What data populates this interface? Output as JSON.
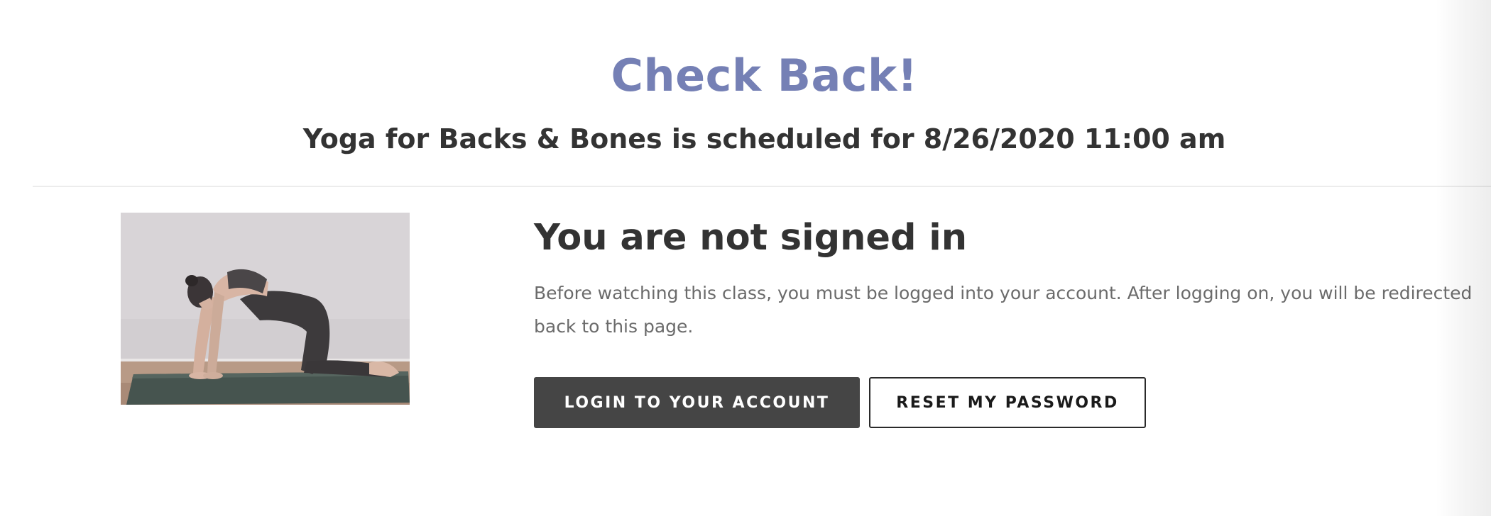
{
  "header": {
    "title": "Check Back!",
    "schedule_text": "Yoga for Backs & Bones is scheduled for 8/26/2020 11:00 am"
  },
  "class_image": {
    "description_name": "yoga-class-thumbnail"
  },
  "signin": {
    "title": "You are not signed in",
    "message": "Before watching this class, you must be logged into your account. After logging on, you will be redirected back to this page.",
    "login_button": "LOGIN TO YOUR ACCOUNT",
    "reset_button": "RESET MY PASSWORD"
  },
  "colors": {
    "accent": "#7580b5",
    "heading": "#333333",
    "body_text": "#6b6b6b",
    "primary_button": "#454545"
  }
}
